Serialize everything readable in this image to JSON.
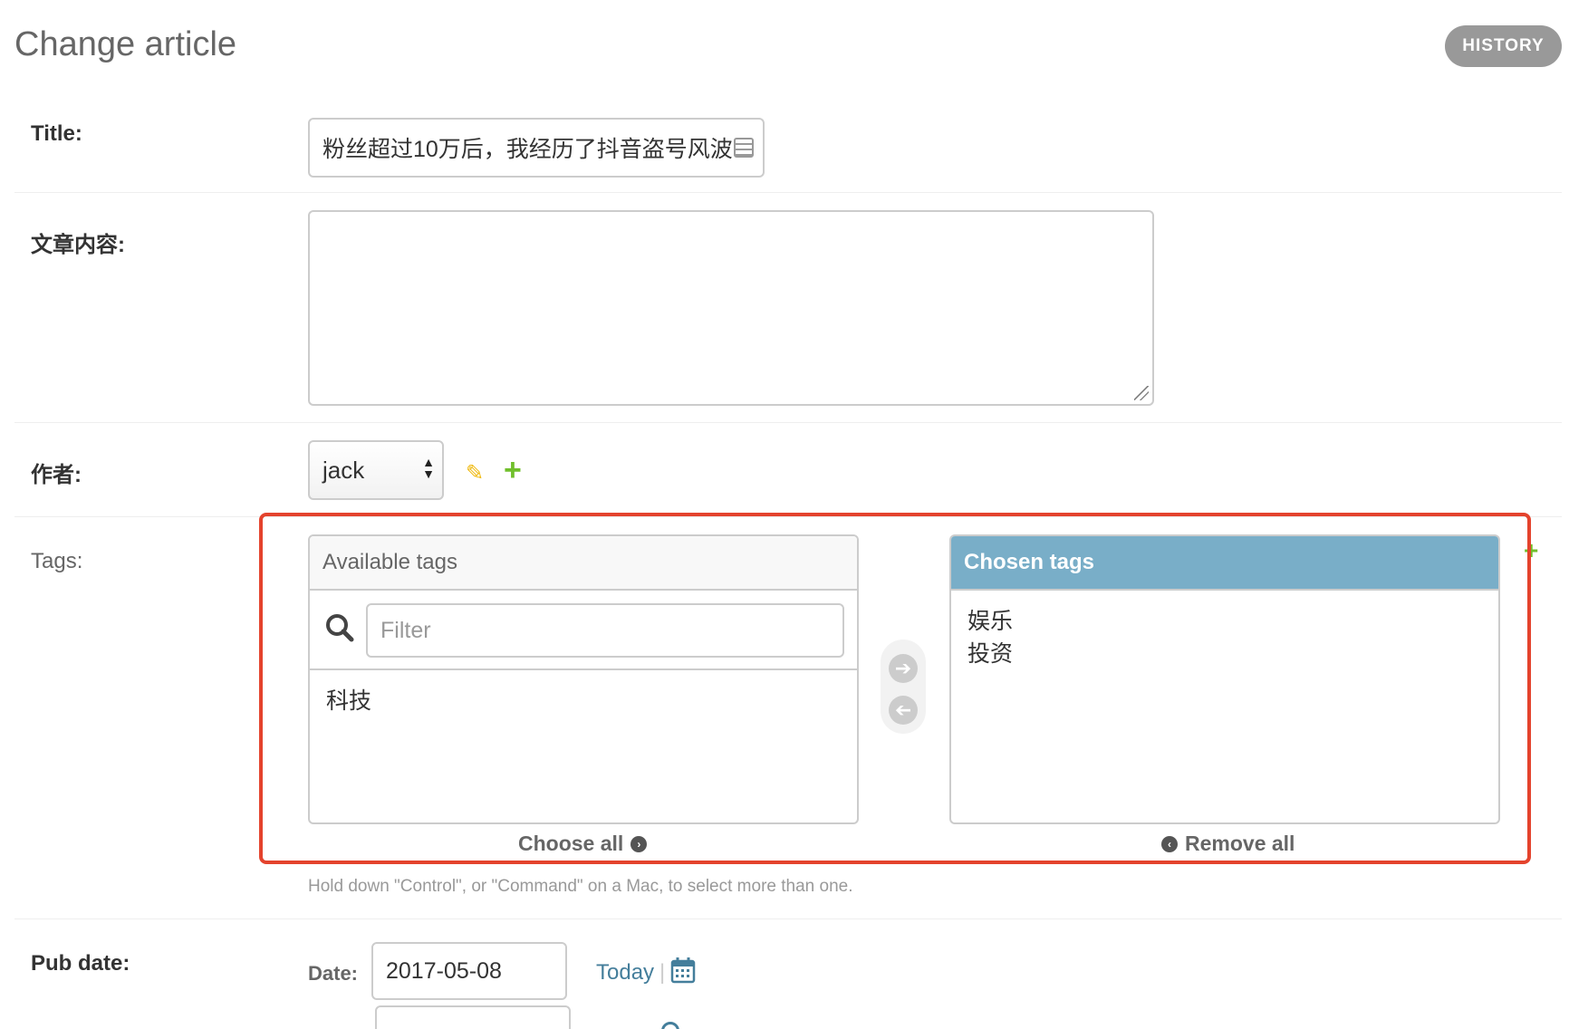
{
  "page": {
    "title": "Change article",
    "history_label": "HISTORY"
  },
  "fields": {
    "title": {
      "label": "Title:",
      "value": "粉丝超过10万后，我经历了抖音盗号风波"
    },
    "content": {
      "label": "文章内容:",
      "value": ""
    },
    "author": {
      "label": "作者:",
      "selected": "jack"
    },
    "tags": {
      "label": "Tags:",
      "available_header": "Available tags",
      "filter_placeholder": "Filter",
      "available_options": [
        "科技"
      ],
      "chosen_header": "Chosen tags",
      "chosen_options": [
        "娱乐",
        "投资"
      ],
      "choose_all_label": "Choose all",
      "remove_all_label": "Remove all",
      "help_text": "Hold down \"Control\", or \"Command\" on a Mac, to select more than one."
    },
    "pub_date": {
      "label": "Pub date:",
      "date_label": "Date:",
      "date_value": "2017-05-08",
      "today_label": "Today",
      "separator": "|"
    }
  },
  "colors": {
    "highlight_border": "#e4432d",
    "chosen_header_bg": "#79aec8",
    "link": "#447e9b",
    "add_green": "#70bf2b",
    "edit_yellow": "#efb80b"
  },
  "icons": {
    "title_autofill": "autofill-icon",
    "author_edit": "pencil-icon",
    "author_add": "plus-icon",
    "filter": "search-icon",
    "move_right": "arrow-right-circle-icon",
    "move_left": "arrow-left-circle-icon",
    "calendar": "calendar-icon"
  }
}
